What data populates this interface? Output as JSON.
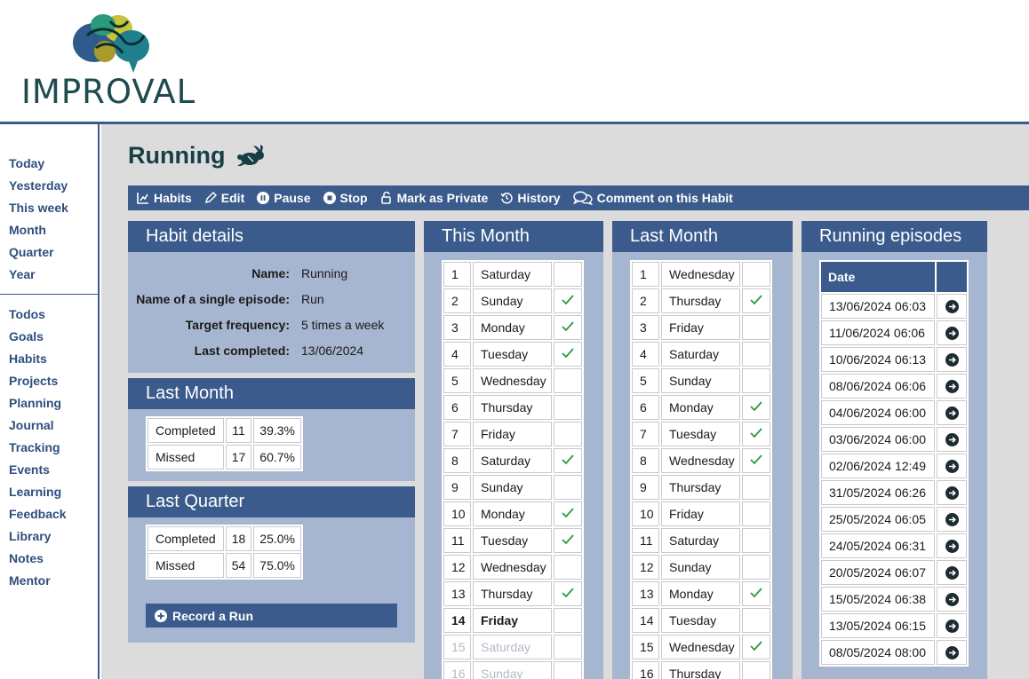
{
  "brand": {
    "name": "IMPROVAL",
    "logo_icon": "brain-logo-icon"
  },
  "nav": {
    "group1": [
      "Today",
      "Yesterday",
      "This week",
      "Month",
      "Quarter",
      "Year"
    ],
    "group2": [
      "Todos",
      "Goals",
      "Habits",
      "Projects",
      "Planning",
      "Journal",
      "Tracking",
      "Events",
      "Learning",
      "Feedback",
      "Library",
      "Notes",
      "Mentor"
    ]
  },
  "page": {
    "title": "Running",
    "title_icon": "rabbit-icon"
  },
  "toolbar": {
    "habits": "Habits",
    "edit": "Edit",
    "pause": "Pause",
    "stop": "Stop",
    "private": "Mark as Private",
    "history": "History",
    "comment": "Comment on this Habit"
  },
  "details": {
    "title": "Habit details",
    "rows": [
      {
        "label": "Name:",
        "value": "Running"
      },
      {
        "label": "Name of a single episode:",
        "value": "Run"
      },
      {
        "label": "Target frequency:",
        "value": "5 times a week"
      },
      {
        "label": "Last completed:",
        "value": "13/06/2024"
      }
    ]
  },
  "last_month_stats": {
    "title": "Last Month",
    "rows": [
      {
        "label": "Completed",
        "count": "11",
        "pct": "39.3%"
      },
      {
        "label": "Missed",
        "count": "17",
        "pct": "60.7%"
      }
    ]
  },
  "last_quarter_stats": {
    "title": "Last Quarter",
    "rows": [
      {
        "label": "Completed",
        "count": "18",
        "pct": "25.0%"
      },
      {
        "label": "Missed",
        "count": "54",
        "pct": "75.0%"
      }
    ]
  },
  "record": {
    "label": "Record a Run"
  },
  "this_month": {
    "title": "This Month",
    "days": [
      {
        "d": "1",
        "w": "Saturday",
        "done": false
      },
      {
        "d": "2",
        "w": "Sunday",
        "done": true
      },
      {
        "d": "3",
        "w": "Monday",
        "done": true
      },
      {
        "d": "4",
        "w": "Tuesday",
        "done": true
      },
      {
        "d": "5",
        "w": "Wednesday",
        "done": false
      },
      {
        "d": "6",
        "w": "Thursday",
        "done": false
      },
      {
        "d": "7",
        "w": "Friday",
        "done": false
      },
      {
        "d": "8",
        "w": "Saturday",
        "done": true
      },
      {
        "d": "9",
        "w": "Sunday",
        "done": false
      },
      {
        "d": "10",
        "w": "Monday",
        "done": true
      },
      {
        "d": "11",
        "w": "Tuesday",
        "done": true
      },
      {
        "d": "12",
        "w": "Wednesday",
        "done": false
      },
      {
        "d": "13",
        "w": "Thursday",
        "done": true
      },
      {
        "d": "14",
        "w": "Friday",
        "done": false,
        "today": true
      },
      {
        "d": "15",
        "w": "Saturday",
        "done": false,
        "future": true
      },
      {
        "d": "16",
        "w": "Sunday",
        "done": false,
        "future": true
      }
    ]
  },
  "last_month": {
    "title": "Last Month",
    "days": [
      {
        "d": "1",
        "w": "Wednesday",
        "done": false
      },
      {
        "d": "2",
        "w": "Thursday",
        "done": true
      },
      {
        "d": "3",
        "w": "Friday",
        "done": false
      },
      {
        "d": "4",
        "w": "Saturday",
        "done": false
      },
      {
        "d": "5",
        "w": "Sunday",
        "done": false
      },
      {
        "d": "6",
        "w": "Monday",
        "done": true
      },
      {
        "d": "7",
        "w": "Tuesday",
        "done": true
      },
      {
        "d": "8",
        "w": "Wednesday",
        "done": true
      },
      {
        "d": "9",
        "w": "Thursday",
        "done": false
      },
      {
        "d": "10",
        "w": "Friday",
        "done": false
      },
      {
        "d": "11",
        "w": "Saturday",
        "done": false
      },
      {
        "d": "12",
        "w": "Sunday",
        "done": false
      },
      {
        "d": "13",
        "w": "Monday",
        "done": true
      },
      {
        "d": "14",
        "w": "Tuesday",
        "done": false
      },
      {
        "d": "15",
        "w": "Wednesday",
        "done": true
      },
      {
        "d": "16",
        "w": "Thursday",
        "done": false
      }
    ]
  },
  "episodes": {
    "title": "Running episodes",
    "col_date": "Date",
    "rows": [
      "13/06/2024 06:03",
      "11/06/2024 06:06",
      "10/06/2024 06:13",
      "08/06/2024 06:06",
      "04/06/2024 06:00",
      "03/06/2024 06:00",
      "02/06/2024 12:49",
      "31/05/2024 06:26",
      "25/05/2024 06:05",
      "24/05/2024 06:31",
      "20/05/2024 06:07",
      "15/05/2024 06:38",
      "13/05/2024 06:15",
      "08/05/2024 08:00"
    ]
  },
  "colors": {
    "accent": "#3a5b8c",
    "panel": "#a7b6d0",
    "check": "#2a9a3c",
    "title": "#163f45"
  }
}
